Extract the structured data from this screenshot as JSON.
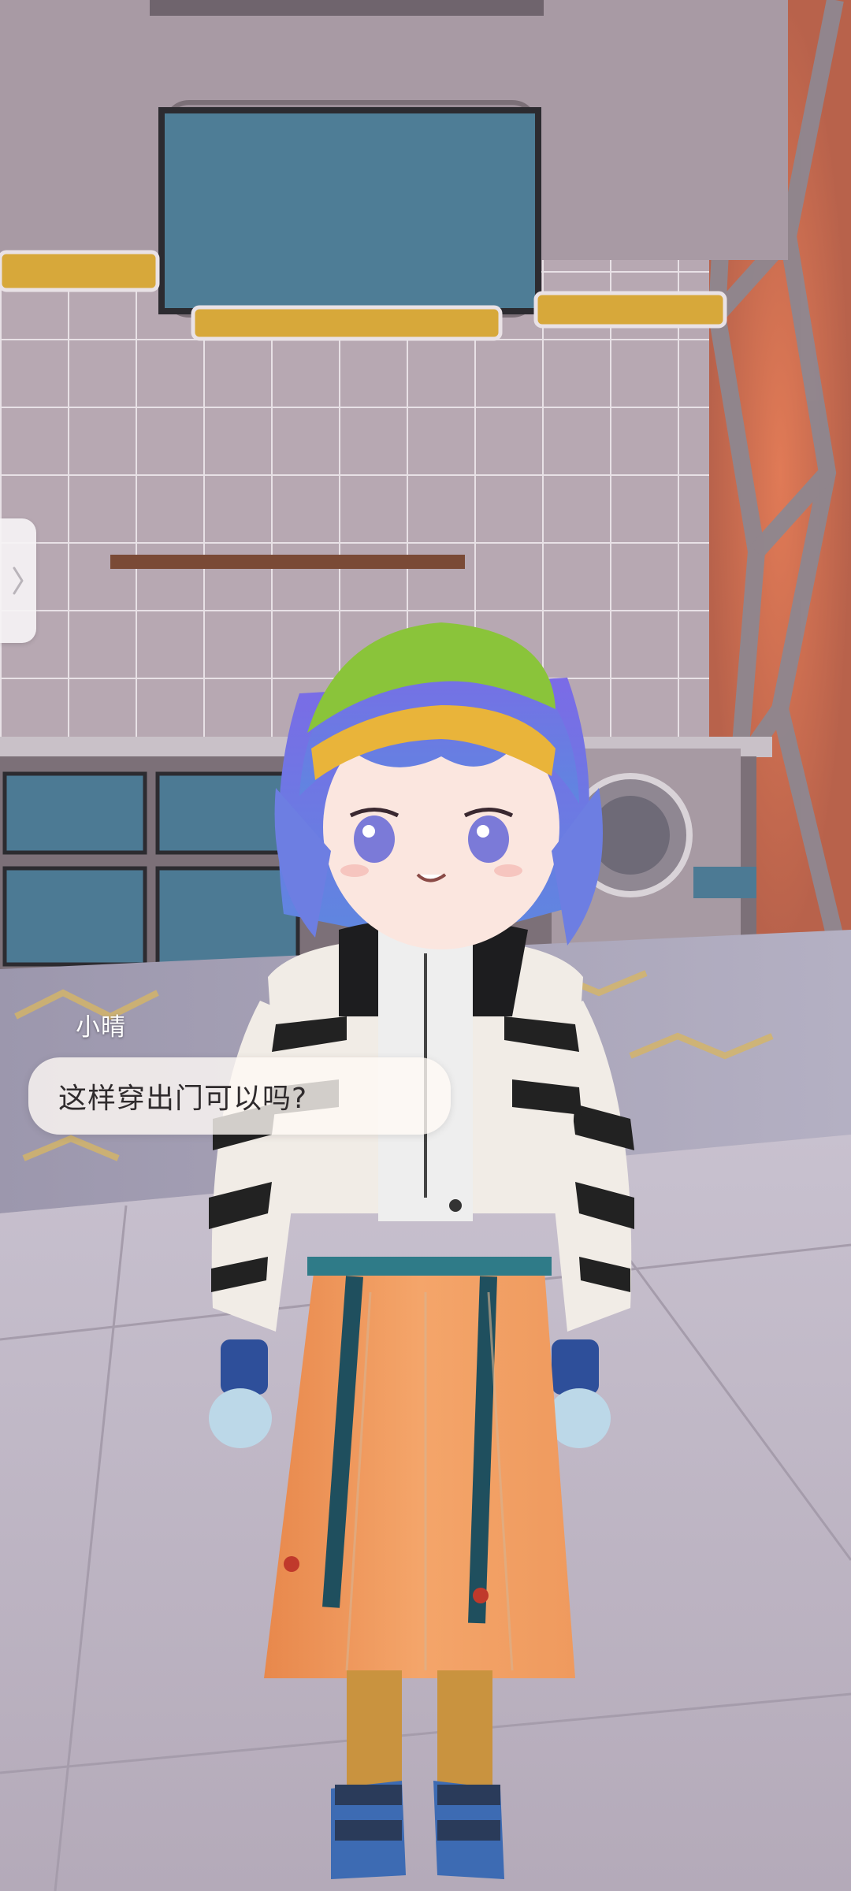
{
  "speaker": {
    "name": "小晴"
  },
  "dialogue": {
    "text": "这样穿出门可以吗?"
  },
  "side_tab": {
    "icon": "chevron-right-icon"
  }
}
